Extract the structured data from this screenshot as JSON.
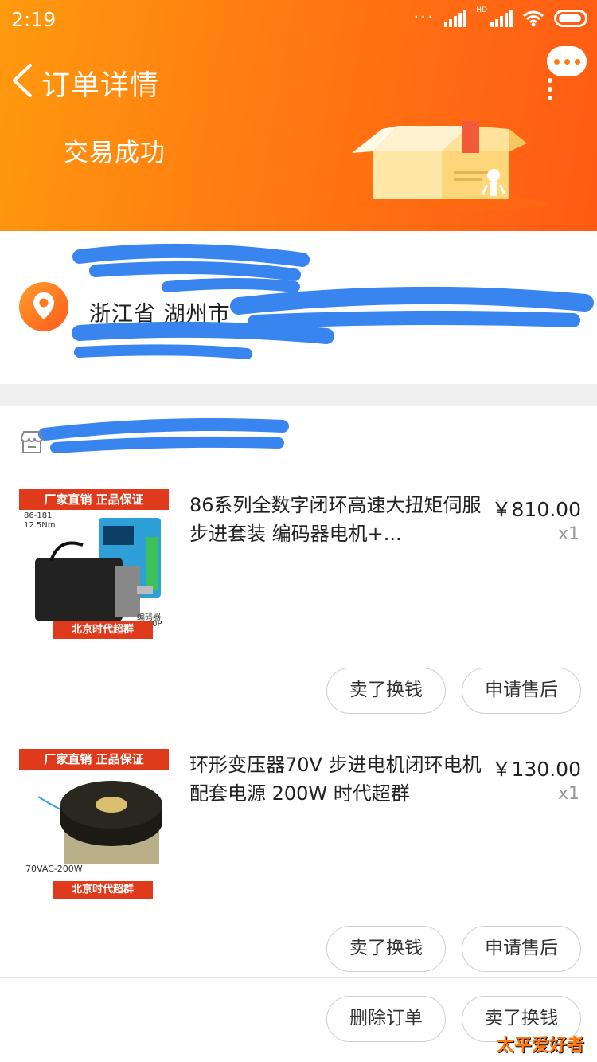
{
  "status_bar": {
    "time": "2:19",
    "network": "HD"
  },
  "header": {
    "title": "订单详情",
    "trade_status": "交易成功"
  },
  "address": {
    "text": "浙江省 湖州市 "
  },
  "products": [
    {
      "title": "86系列全数字闭环高速大扭矩伺服步进套装 编码器电机+...",
      "price": "￥810.00",
      "qty": "x1",
      "image": {
        "banner": "厂家直销 正品保证",
        "tag_model": "86-181",
        "tag_torque": "12.5Nm",
        "tag_encoder": "编码器",
        "tag_encoder_res": "1000P",
        "footer": "北京时代超群"
      },
      "buttons": [
        "卖了换钱",
        "申请售后"
      ]
    },
    {
      "title": "环形变压器70V 步进电机闭环电机配套电源 200W 时代超群",
      "price": "￥130.00",
      "qty": "x1",
      "image": {
        "banner": "厂家直销 正品保证",
        "tag_spec": "70VAC-200W",
        "footer": "北京时代超群"
      },
      "buttons": [
        "卖了换钱",
        "申请售后"
      ]
    }
  ],
  "order_actions": [
    "删除订单",
    "卖了换钱"
  ],
  "watermark": "太平爱好者",
  "colors": {
    "accent": "#ff7a12",
    "banner_red": "#e03a1c",
    "scribble": "#2e7ff0"
  }
}
